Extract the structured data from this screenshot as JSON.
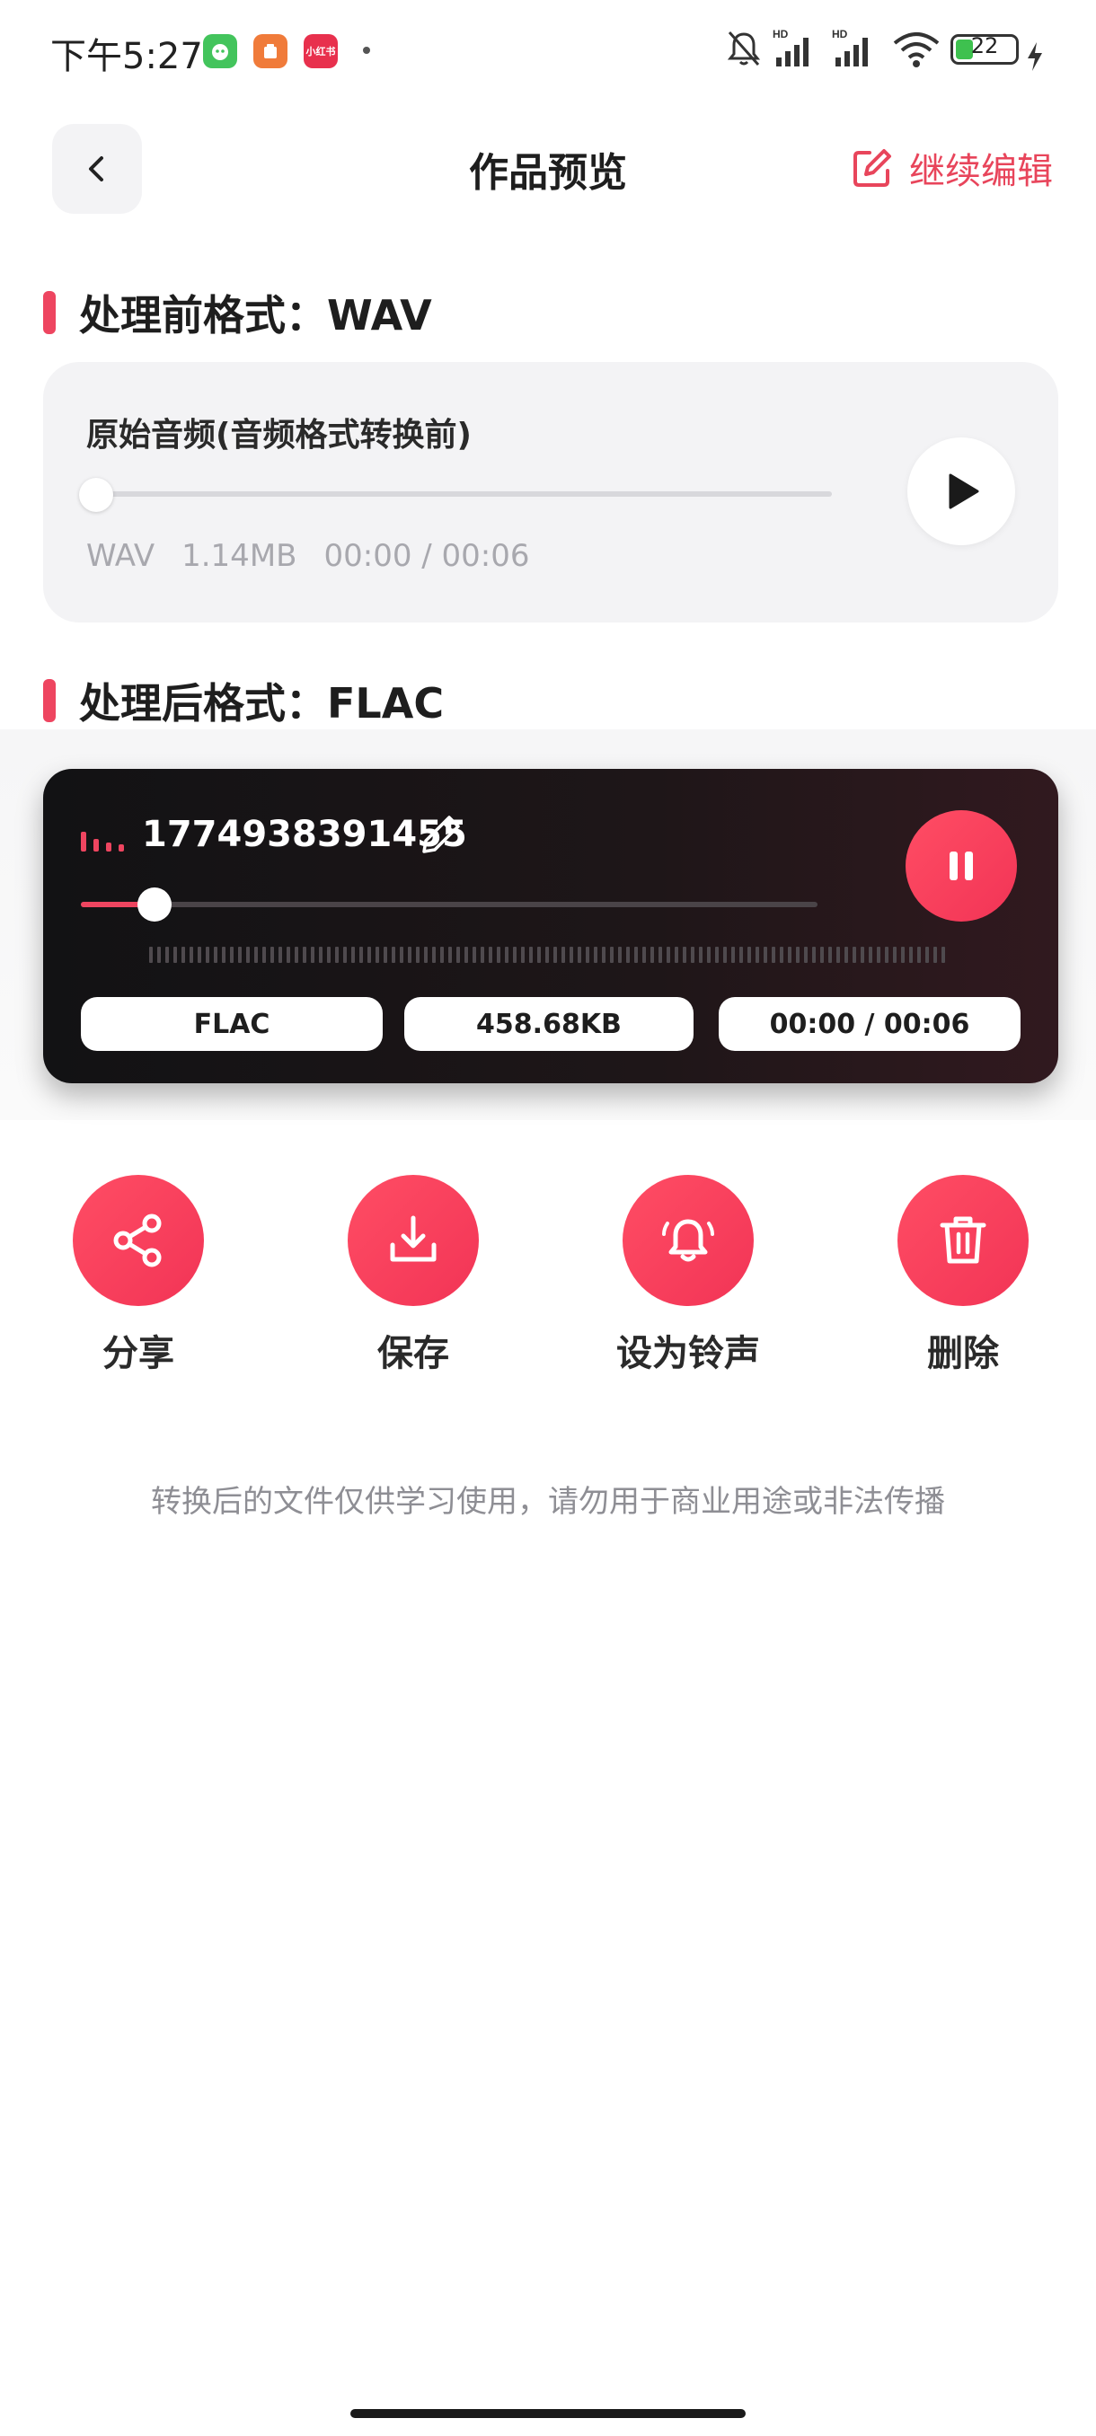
{
  "status_bar": {
    "time": "下午5:27",
    "app_icons": [
      {
        "name": "green-app-icon",
        "color": "#43c45c",
        "label": ""
      },
      {
        "name": "orange-app-icon",
        "color": "#f07b3a",
        "label": ""
      },
      {
        "name": "red-app-icon",
        "color": "#e8304d",
        "label": "小红书"
      }
    ],
    "battery": "22"
  },
  "header": {
    "title": "作品预览",
    "continue_edit_label": "继续编辑"
  },
  "before": {
    "section_title": "处理前格式：WAV",
    "card_title": "原始音频(音频格式转换前)",
    "format": "WAV",
    "size": "1.14MB",
    "time": "00:00 / 00:06",
    "progress": 0
  },
  "after": {
    "section_title": "处理后格式：FLAC",
    "file_name": "1774938391455",
    "format": "FLAC",
    "size": "458.68KB",
    "time": "00:00 / 00:06",
    "progress": 0.1
  },
  "actions": [
    {
      "name": "share",
      "label": "分享",
      "icon": "share-icon"
    },
    {
      "name": "save",
      "label": "保存",
      "icon": "download-icon"
    },
    {
      "name": "set-ringtone",
      "label": "设为铃声",
      "icon": "bell-icon"
    },
    {
      "name": "delete",
      "label": "删除",
      "icon": "trash-icon"
    }
  ],
  "disclaimer": "转换后的文件仅供学习使用，请勿用于商业用途或非法传播",
  "colors": {
    "accent": "#ee4560",
    "card_dark": "#121214"
  }
}
